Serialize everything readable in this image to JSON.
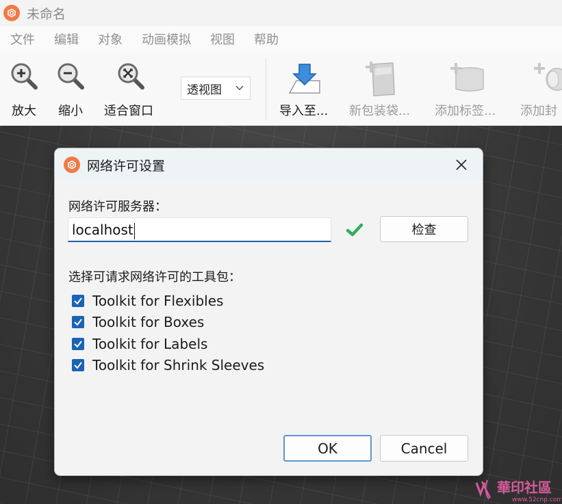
{
  "window": {
    "title": "未命名"
  },
  "menu": [
    "文件",
    "编辑",
    "对象",
    "动画模拟",
    "视图",
    "帮助"
  ],
  "toolbar": {
    "zoom_in": "放大",
    "zoom_out": "缩小",
    "fit_window": "适合窗口",
    "view_mode": "透视图",
    "import_to": "导入至...",
    "new_pack": "新包装袋...",
    "add_label": "添加标签...",
    "add_seal": "添加封"
  },
  "dialog": {
    "title": "网络许可设置",
    "server_label": "网络许可服务器：",
    "server_value": "localhost",
    "check_button": "检查",
    "toolkits_label": "选择可请求网络许可的工具包：",
    "toolkits": [
      {
        "label": "Toolkit for Flexibles",
        "checked": true
      },
      {
        "label": "Toolkit for Boxes",
        "checked": true
      },
      {
        "label": "Toolkit for Labels",
        "checked": true
      },
      {
        "label": "Toolkit for Shrink Sleeves",
        "checked": true
      }
    ],
    "ok_label": "OK",
    "cancel_label": "Cancel"
  },
  "watermark": {
    "text": "華印社區",
    "url_text": "www.52cnp.com"
  },
  "colors": {
    "brand": "#f07a45",
    "accent": "#1b63b5",
    "check": "#2fae5a"
  }
}
